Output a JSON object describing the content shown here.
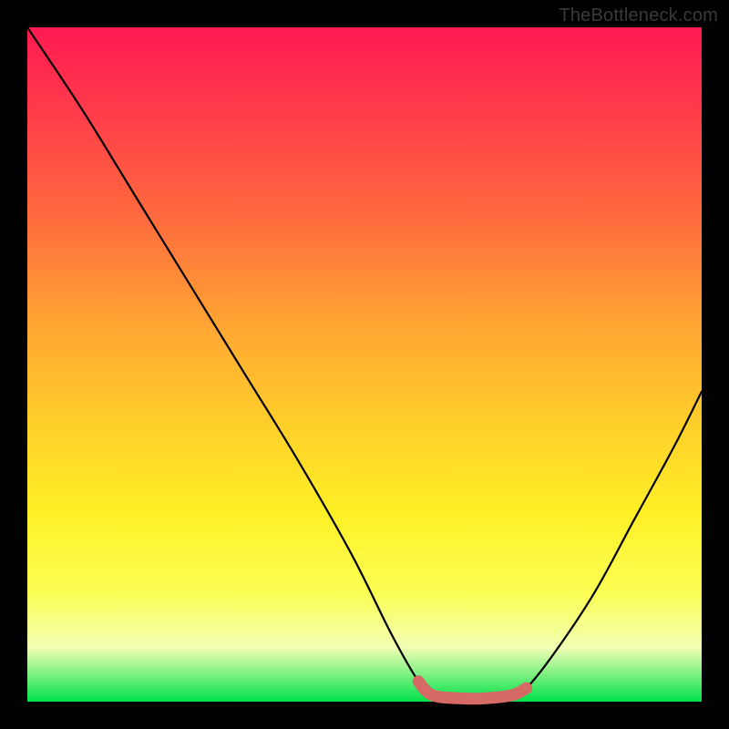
{
  "watermark": "TheBottleneck.com",
  "chart_data": {
    "type": "line",
    "title": "",
    "xlabel": "",
    "ylabel": "",
    "xlim": [
      0,
      100
    ],
    "ylim": [
      0,
      100
    ],
    "series": [
      {
        "name": "bottleneck-curve",
        "x": [
          0,
          8,
          16,
          24,
          32,
          40,
          48,
          54,
          58,
          60,
          64,
          68,
          72,
          74,
          78,
          84,
          90,
          96,
          100
        ],
        "y": [
          100,
          88,
          75,
          62,
          49,
          36,
          22,
          10,
          3,
          1,
          0.5,
          0.5,
          1,
          2,
          7,
          16,
          27,
          38,
          46
        ]
      }
    ],
    "highlight_segment": {
      "name": "optimal-range",
      "x_start": 58,
      "x_end": 74,
      "color": "#d46a63"
    },
    "background_gradient": {
      "stops": [
        {
          "pos": 0.0,
          "color": "#ff1a52"
        },
        {
          "pos": 0.45,
          "color": "#ffa832"
        },
        {
          "pos": 0.72,
          "color": "#fff026"
        },
        {
          "pos": 1.0,
          "color": "#00e04a"
        }
      ]
    }
  }
}
